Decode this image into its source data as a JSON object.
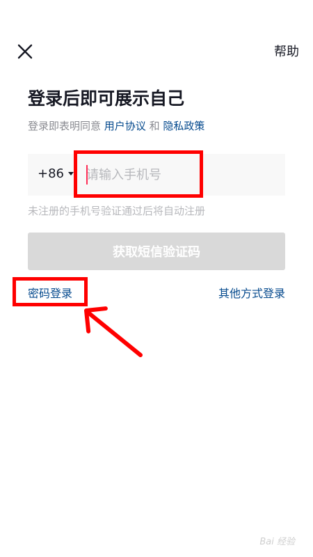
{
  "header": {
    "close_icon": "close-icon",
    "help_label": "帮助"
  },
  "main": {
    "title": "登录后即可展示自己",
    "agreement": {
      "prefix": "登录即表明同意",
      "user_agreement": "用户协议",
      "and": "和",
      "privacy_policy": "隐私政策"
    },
    "phone": {
      "country_code": "+86",
      "placeholder": "请输入手机号",
      "value": ""
    },
    "hint": "未注册的手机号验证通过后将自动注册",
    "sms_button_label": "获取短信验证码",
    "password_login_label": "密码登录",
    "other_login_label": "其他方式登录"
  },
  "colors": {
    "link": "#04498d",
    "button_disabled": "#d9d9d9",
    "highlight": "#ff0000",
    "cursor": "#fe2c55"
  },
  "watermark": {
    "text": "Bai 经验"
  }
}
